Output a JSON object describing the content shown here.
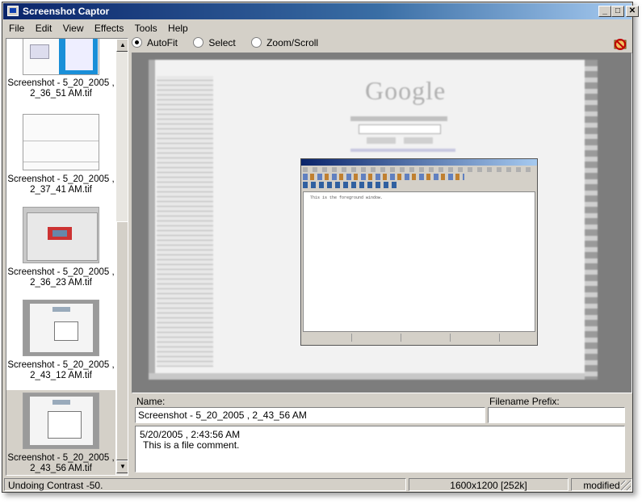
{
  "window": {
    "title": "Screenshot Captor"
  },
  "menu": [
    "File",
    "Edit",
    "View",
    "Effects",
    "Tools",
    "Help"
  ],
  "thumbnails": [
    {
      "caption_line1": "Screenshot - 5_20_2005 ,",
      "caption_line2": "2_36_51 AM.tif",
      "selected": false
    },
    {
      "caption_line1": "Screenshot - 5_20_2005 ,",
      "caption_line2": "2_37_41 AM.tif",
      "selected": false
    },
    {
      "caption_line1": "Screenshot - 5_20_2005 ,",
      "caption_line2": "2_36_23 AM.tif",
      "selected": false
    },
    {
      "caption_line1": "Screenshot - 5_20_2005 ,",
      "caption_line2": "2_43_12 AM.tif",
      "selected": false
    },
    {
      "caption_line1": "Screenshot - 5_20_2005 ,",
      "caption_line2": "2_43_56 AM.tif",
      "selected": true
    }
  ],
  "view_modes": {
    "autofit": "AutoFit",
    "select": "Select",
    "zoom": "Zoom/Scroll",
    "selected": "AutoFit"
  },
  "preview": {
    "logo_text": "Google",
    "inner_window_text": "This is the foreground window."
  },
  "details": {
    "name_label": "Name:",
    "name_value": "Screenshot - 5_20_2005 , 2_43_56 AM",
    "prefix_label": "Filename Prefix:",
    "prefix_value": "",
    "comment_line1": "5/20/2005 , 2:43:56 AM",
    "comment_line2": "This is a file comment."
  },
  "status": {
    "message": "Undoing Contrast -50.",
    "dimensions": "1600x1200  [252k]",
    "state": "modified"
  }
}
